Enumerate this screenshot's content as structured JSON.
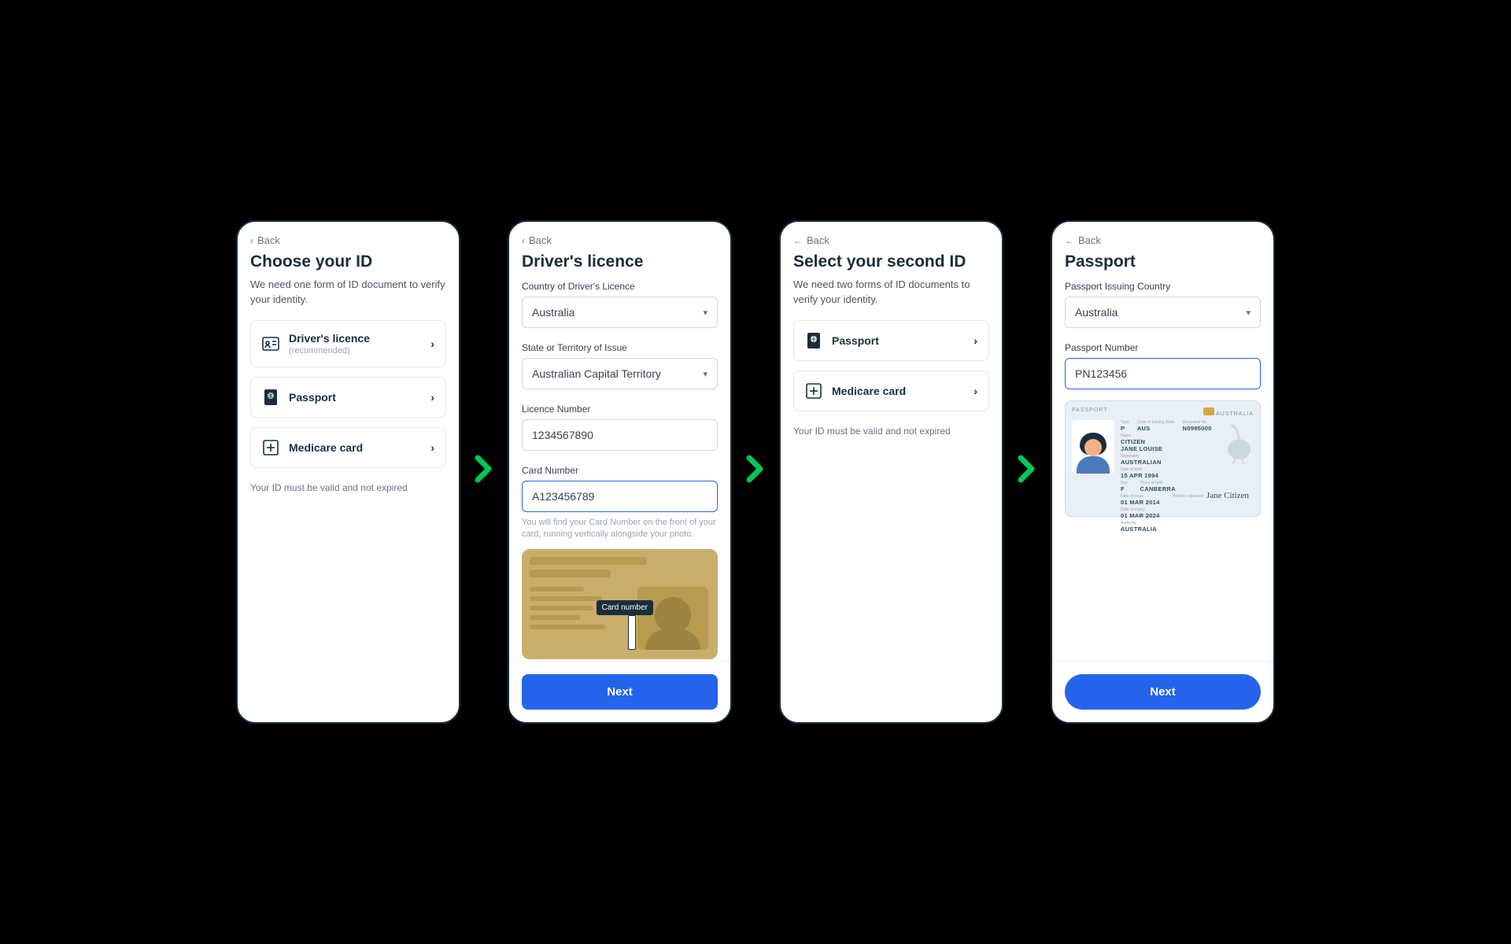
{
  "arrows": {
    "glyph": "›"
  },
  "screen1": {
    "back": "Back",
    "title": "Choose your ID",
    "subtitle": "We need one form of ID document to verify your identity.",
    "options": [
      {
        "label": "Driver's licence",
        "sub": "(recommended)"
      },
      {
        "label": "Passport"
      },
      {
        "label": "Medicare card"
      }
    ],
    "note": "Your ID must be valid and not expired"
  },
  "screen2": {
    "back": "Back",
    "title": "Driver's licence",
    "fields": {
      "country_label": "Country of Driver's Licence",
      "country_value": "Australia",
      "state_label": "State or Territory of Issue",
      "state_value": "Australian Capital Territory",
      "licence_label": "Licence Number",
      "licence_value": "1234567890",
      "card_label": "Card Number",
      "card_value": "A123456789",
      "card_helper": "You will find your Card Number on the front of your card, running vertically alongside your photo."
    },
    "illust_badge": "Card number",
    "next": "Next"
  },
  "screen3": {
    "back": "Back",
    "title": "Select your second ID",
    "subtitle": "We need two forms of ID documents to verify your identity.",
    "options": [
      {
        "label": "Passport"
      },
      {
        "label": "Medicare card"
      }
    ],
    "note": "Your ID must be valid and not expired"
  },
  "screen4": {
    "back": "Back",
    "title": "Passport",
    "fields": {
      "country_label": "Passport Issuing Country",
      "country_value": "Australia",
      "number_label": "Passport Number",
      "number_value": "PN123456"
    },
    "passport": {
      "top_left": "PASSPORT",
      "top_right": "AUSTRALIA",
      "type_k": "Type",
      "type_v": "P",
      "code_k": "Code of Issuing State",
      "code_v": "AUS",
      "docno_k": "Document No.",
      "docno_v": "N0995000",
      "name_k": "Name",
      "name_v1": "CITIZEN",
      "name_v2": "JANE LOUISE",
      "nat_k": "Nationality",
      "nat_v": "AUSTRALIAN",
      "dob_k": "Date of birth",
      "dob_v": "15 APR 1994",
      "sex_k": "Sex",
      "sex_v": "F",
      "pob_k": "Place of birth",
      "pob_v": "CANBERRA",
      "doi_k": "Date of issue",
      "doi_v": "01 MAR 2014",
      "doe_k": "Date of expiry",
      "doe_v": "01 MAR 2024",
      "auth_k": "Authority",
      "auth_v": "AUSTRALIA",
      "sig_k": "Holder's signature",
      "sig": "Jane Citizen"
    },
    "next": "Next"
  }
}
